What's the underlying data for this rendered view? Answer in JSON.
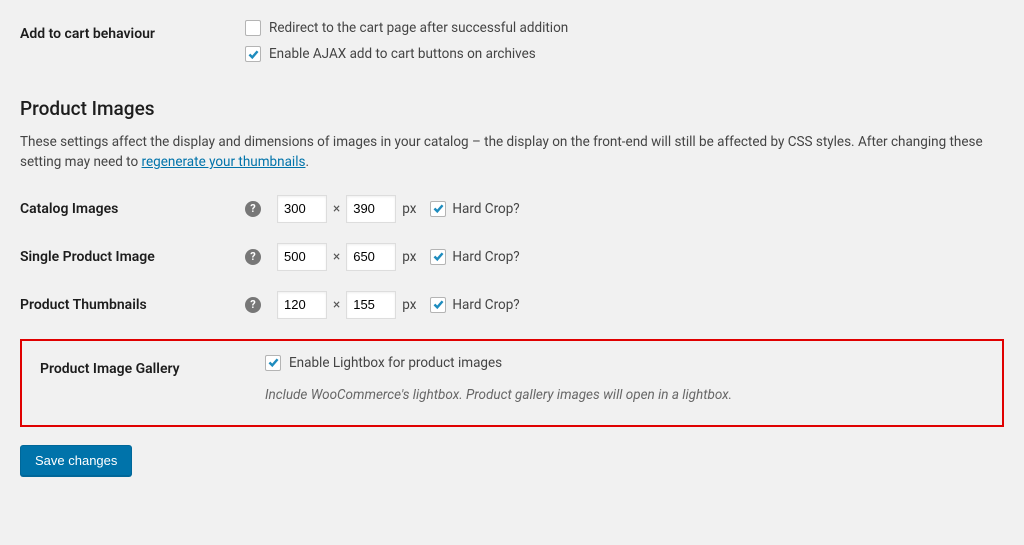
{
  "add_to_cart": {
    "label": "Add to cart behaviour",
    "redirect_label": "Redirect to the cart page after successful addition",
    "ajax_label": "Enable AJAX add to cart buttons on archives"
  },
  "product_images": {
    "title": "Product Images",
    "desc_prefix": "These settings affect the display and dimensions of images in your catalog – the display on the front-end will still be affected by CSS styles. After changing these setting",
    "desc_mid": " may need to ",
    "regen_link": "regenerate your thumbnails",
    "desc_end": "."
  },
  "catalog": {
    "label": "Catalog Images",
    "w": "300",
    "h": "390",
    "px": "px",
    "crop": "Hard Crop?"
  },
  "single": {
    "label": "Single Product Image",
    "w": "500",
    "h": "650",
    "px": "px",
    "crop": "Hard Crop?"
  },
  "thumbs": {
    "label": "Product Thumbnails",
    "w": "120",
    "h": "155",
    "px": "px",
    "crop": "Hard Crop?"
  },
  "gallery": {
    "label": "Product Image Gallery",
    "enable": "Enable Lightbox for product images",
    "desc": "Include WooCommerce's lightbox. Product gallery images will open in a lightbox."
  },
  "save": "Save changes",
  "times": "×",
  "help": "?"
}
